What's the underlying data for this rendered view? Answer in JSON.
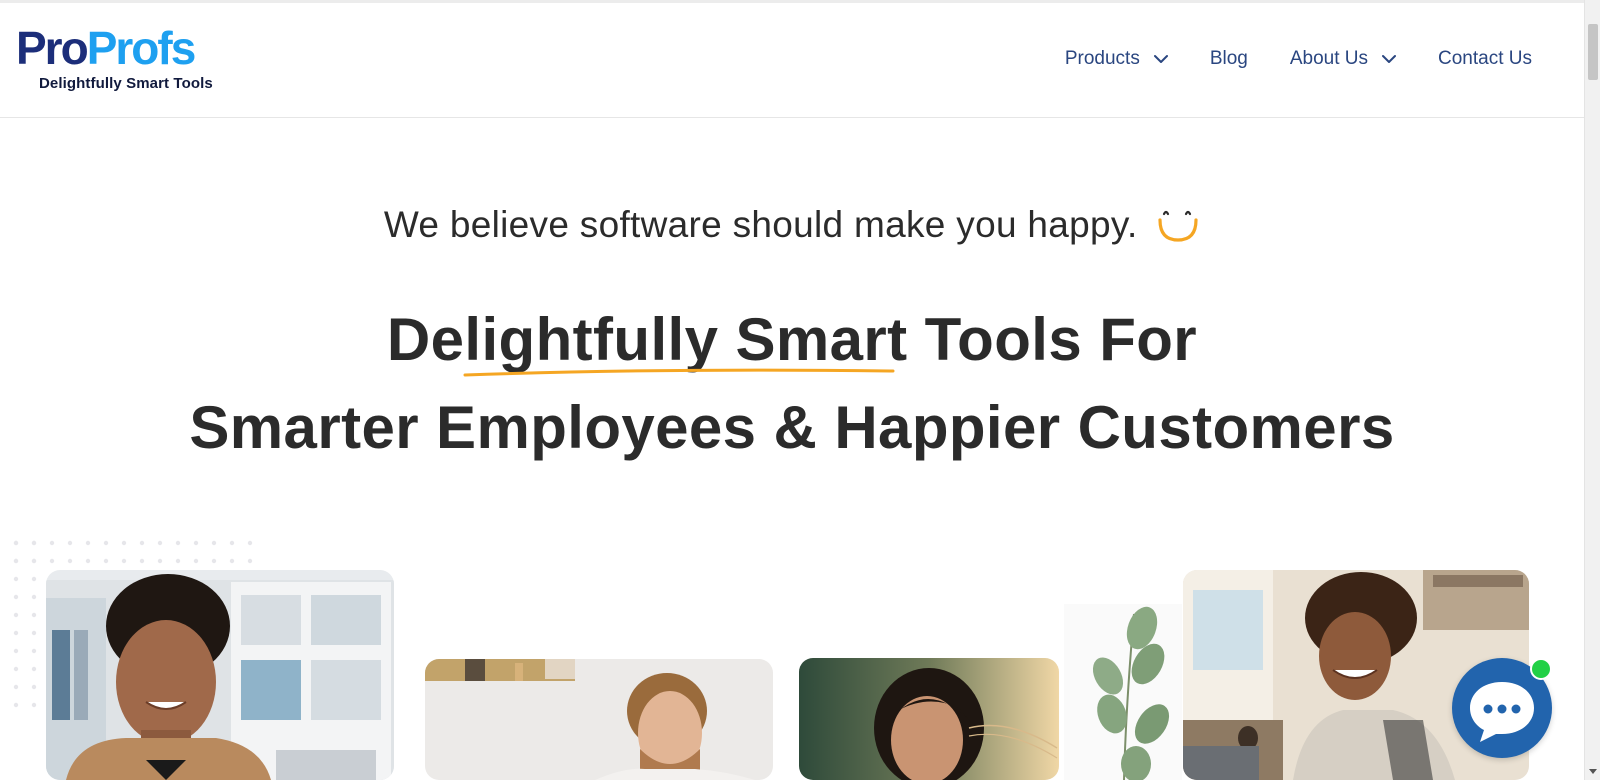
{
  "logo": {
    "word_part1": "Pro",
    "word_part2": "Profs",
    "tagline": "Delightfully Smart Tools"
  },
  "nav": {
    "items": [
      {
        "label": "Products",
        "has_dropdown": true
      },
      {
        "label": "Blog",
        "has_dropdown": false
      },
      {
        "label": "About Us",
        "has_dropdown": true
      },
      {
        "label": "Contact Us",
        "has_dropdown": false
      }
    ]
  },
  "hero": {
    "tagline": "We believe software should make you happy.",
    "headline_line1": "Delightfully Smart Tools For",
    "headline_line2": "Smarter Employees & Happier Customers"
  },
  "icons": {
    "smile": "smile-icon",
    "chevron": "chevron-down-icon",
    "chat": "chat-bubble-icon"
  },
  "colors": {
    "brand_dark": "#1c2e7a",
    "brand_light": "#1ea0f0",
    "nav_text": "#2a4680",
    "accent_orange": "#f5a623",
    "chat_blue": "#2264ad",
    "online_green": "#22d046"
  }
}
